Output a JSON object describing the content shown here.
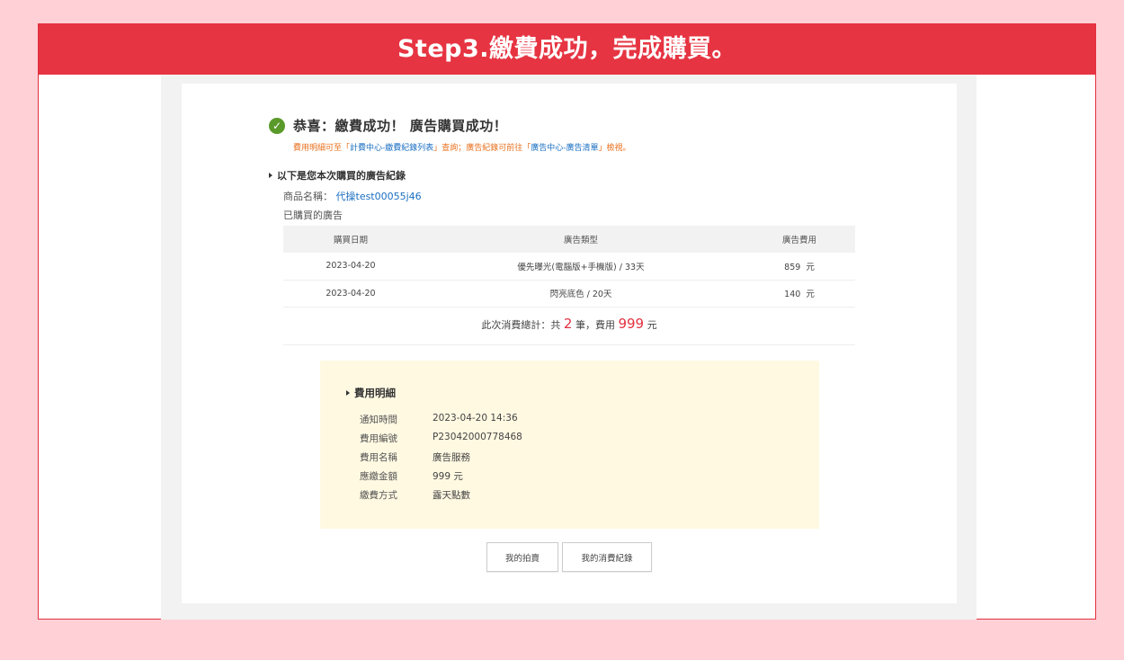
{
  "banner": {
    "title": "Step3.繳費成功，完成購買。"
  },
  "success": {
    "icon": "check-circle-icon",
    "title": "恭喜：繳費成功！ 廣告購買成功！",
    "note_prefix": "費用明細可至「",
    "note_link1": "計費中心-繳費紀錄列表",
    "note_mid": "」查詢；廣告紀錄可前往「",
    "note_link2": "廣告中心-廣告清單",
    "note_suffix": "」檢視。"
  },
  "purchase": {
    "section_title": "以下是您本次購買的廣告紀錄",
    "product_label": "商品名稱：",
    "product_value": "代操test00055j46",
    "bought_label": "已購買的廣告",
    "columns": [
      "購買日期",
      "廣告類型",
      "廣告費用"
    ],
    "rows": [
      {
        "date": "2023-04-20",
        "type": "優先曝光(電腦版+手機版) / 33天",
        "fee": "859  元"
      },
      {
        "date": "2023-04-20",
        "type": "閃亮底色 / 20天",
        "fee": "140  元"
      }
    ],
    "total_prefix": "此次消費總計：共",
    "total_count": "2",
    "total_mid": "筆，費用",
    "total_amount": "999",
    "total_suffix": "元"
  },
  "detail": {
    "title": "費用明細",
    "rows": [
      {
        "label": "通知時間",
        "value": "2023-04-20 14:36"
      },
      {
        "label": "費用編號",
        "value": "P23042000778468"
      },
      {
        "label": "費用名稱",
        "value": "廣告服務"
      },
      {
        "label": "應繳金額",
        "value": "999 元"
      },
      {
        "label": "繳費方式",
        "value": "露天點數"
      }
    ]
  },
  "buttons": {
    "my_auctions": "我的拍賣",
    "my_spending": "我的消費紀錄"
  },
  "colors": {
    "banner": "#e63442",
    "page_bg": "#ffd1d7",
    "success": "#5a9a2a",
    "note": "#e86f1c",
    "link": "#1a6fc1",
    "highlight": "#e3303f",
    "detail_bg": "#fff9e2"
  }
}
